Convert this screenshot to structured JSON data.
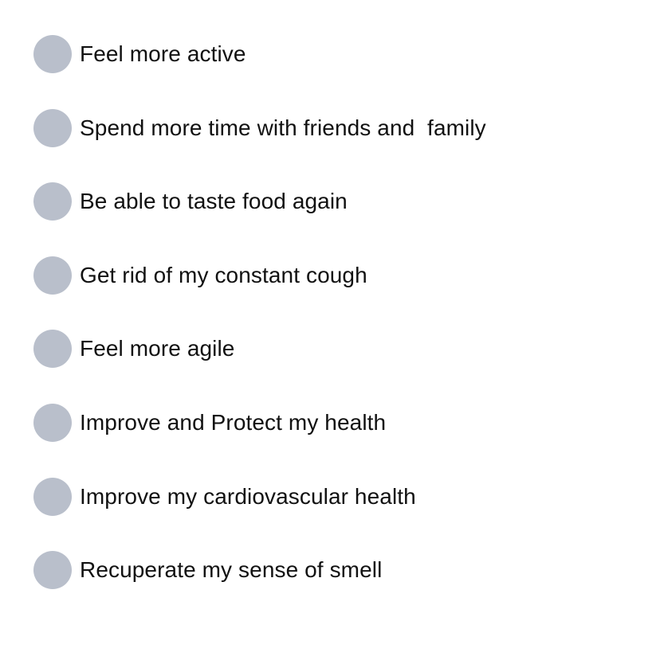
{
  "options": [
    {
      "label": "Feel more active",
      "selected": false
    },
    {
      "label": "Spend more time with friends and  family",
      "selected": false
    },
    {
      "label": "Be able to taste food again",
      "selected": false
    },
    {
      "label": "Get rid of my constant cough",
      "selected": false
    },
    {
      "label": "Feel more agile",
      "selected": false
    },
    {
      "label": "Improve and Protect my health",
      "selected": false
    },
    {
      "label": "Improve my cardiovascular health",
      "selected": false
    },
    {
      "label": "Recuperate my sense of smell",
      "selected": false
    }
  ],
  "colors": {
    "radio_unselected": "#b9bfcb",
    "text": "#111111",
    "background": "#ffffff"
  }
}
